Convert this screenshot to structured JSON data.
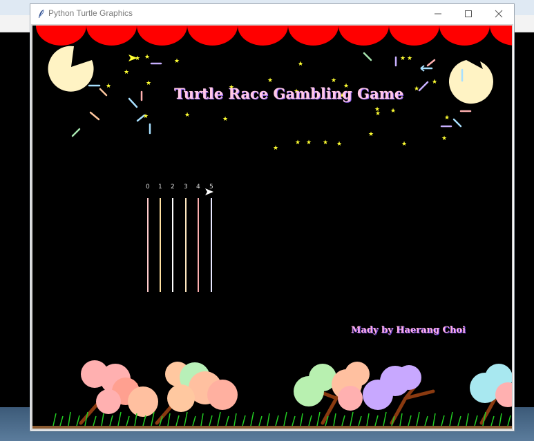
{
  "window": {
    "title": "Python Turtle Graphics",
    "controls": [
      "minimize",
      "maximize",
      "close"
    ]
  },
  "scene": {
    "heading": "Turtle Race Gambling Game",
    "credit": "Mady by Haerang Choi",
    "lane_numbers": [
      "0",
      "1",
      "2",
      "3",
      "4",
      "5"
    ],
    "lane_colors": [
      "#ffcccc",
      "#ffe0a0",
      "#ffffff",
      "#ffe8c0",
      "#ffb0b0",
      "#e8e8ff"
    ]
  },
  "colors": {
    "awning": "#ff0000",
    "background": "#000000",
    "title_text": "#ffc8e6",
    "stars": "#ffff33",
    "pacman": "#fff3c4",
    "grass": "#22cc22"
  },
  "icons": [
    "feather-icon",
    "minimize-icon",
    "maximize-icon",
    "close-icon",
    "turtle-cursor-icon"
  ]
}
